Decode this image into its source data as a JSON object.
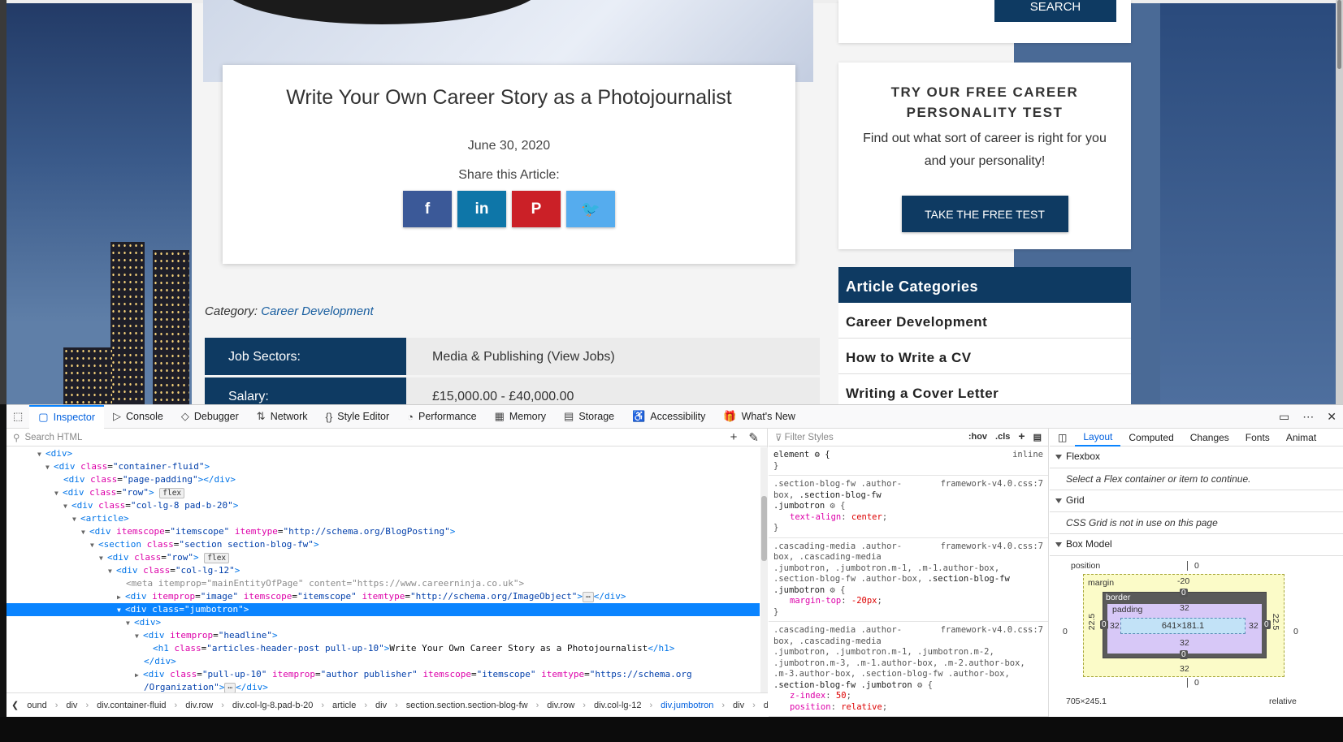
{
  "site": {
    "search_btn": "SEARCH",
    "article_title": "Write Your Own Career Story as a Photojournalist",
    "date": "June 30, 2020",
    "share_label": "Share this Article:",
    "share_buttons": [
      {
        "icon": "f",
        "color": "#3b5998"
      },
      {
        "icon": "in",
        "color": "#0e76a8"
      },
      {
        "icon": "P",
        "color": "#cb2027"
      },
      {
        "icon": "🐦",
        "color": "#55acee"
      }
    ],
    "category_label": "Category:",
    "category_value": "Career Development",
    "job_rows": [
      {
        "key": "Job Sectors:",
        "value": "Media & Publishing (View Jobs)"
      },
      {
        "key": "Salary:",
        "value": "£15,000.00 - £40,000.00"
      }
    ],
    "test_title_1": "TRY OUR FREE CAREER",
    "test_title_2": "PERSONALITY TEST",
    "test_desc": "Find out what sort of career is right for you and your personality!",
    "test_btn": "TAKE THE FREE TEST",
    "cats_header": "Article Categories",
    "cats": [
      "Career Development",
      "How to Write a CV",
      "Writing a Cover Letter"
    ]
  },
  "devtools": {
    "tabs": [
      {
        "label": "Inspector",
        "icon": "▢"
      },
      {
        "label": "Console",
        "icon": "▷"
      },
      {
        "label": "Debugger",
        "icon": "◇"
      },
      {
        "label": "Network",
        "icon": "⇅"
      },
      {
        "label": "Style Editor",
        "icon": "{}"
      },
      {
        "label": "Performance",
        "icon": "◔"
      },
      {
        "label": "Memory",
        "icon": "▦"
      },
      {
        "label": "Storage",
        "icon": "▤"
      },
      {
        "label": "Accessibility",
        "icon": "♿"
      },
      {
        "label": "What's New",
        "icon": "🎁"
      }
    ],
    "search_placeholder": "Search HTML",
    "filter_placeholder": "Filter Styles",
    "hov": ":hov",
    "cls": ".cls",
    "breadcrumbs": [
      "ound",
      "div",
      "div.container-fluid",
      "div.row",
      "div.col-lg-8.pad-b-20",
      "article",
      "div",
      "section.section.section-blog-fw",
      "div.row",
      "div.col-lg-12",
      "div.jumbotron",
      "div",
      "div"
    ],
    "layout_tabs": [
      "Layout",
      "Computed",
      "Changes",
      "Fonts",
      "Animat"
    ],
    "flexbox": "Flexbox",
    "flexbox_note": "Select a Flex container or item to continue.",
    "grid": "Grid",
    "grid_note": "CSS Grid is not in use on this page",
    "boxmodel": "Box Model",
    "bm": {
      "position": "position",
      "margin": "margin",
      "border": "border",
      "padding": "padding",
      "content": "641×181.1",
      "size": "705×245.1",
      "pos_type": "relative",
      "margin_top": "-20",
      "margin_bottom": "32",
      "margin_side": "22.5",
      "padding_val": "32",
      "zero": "0"
    }
  }
}
